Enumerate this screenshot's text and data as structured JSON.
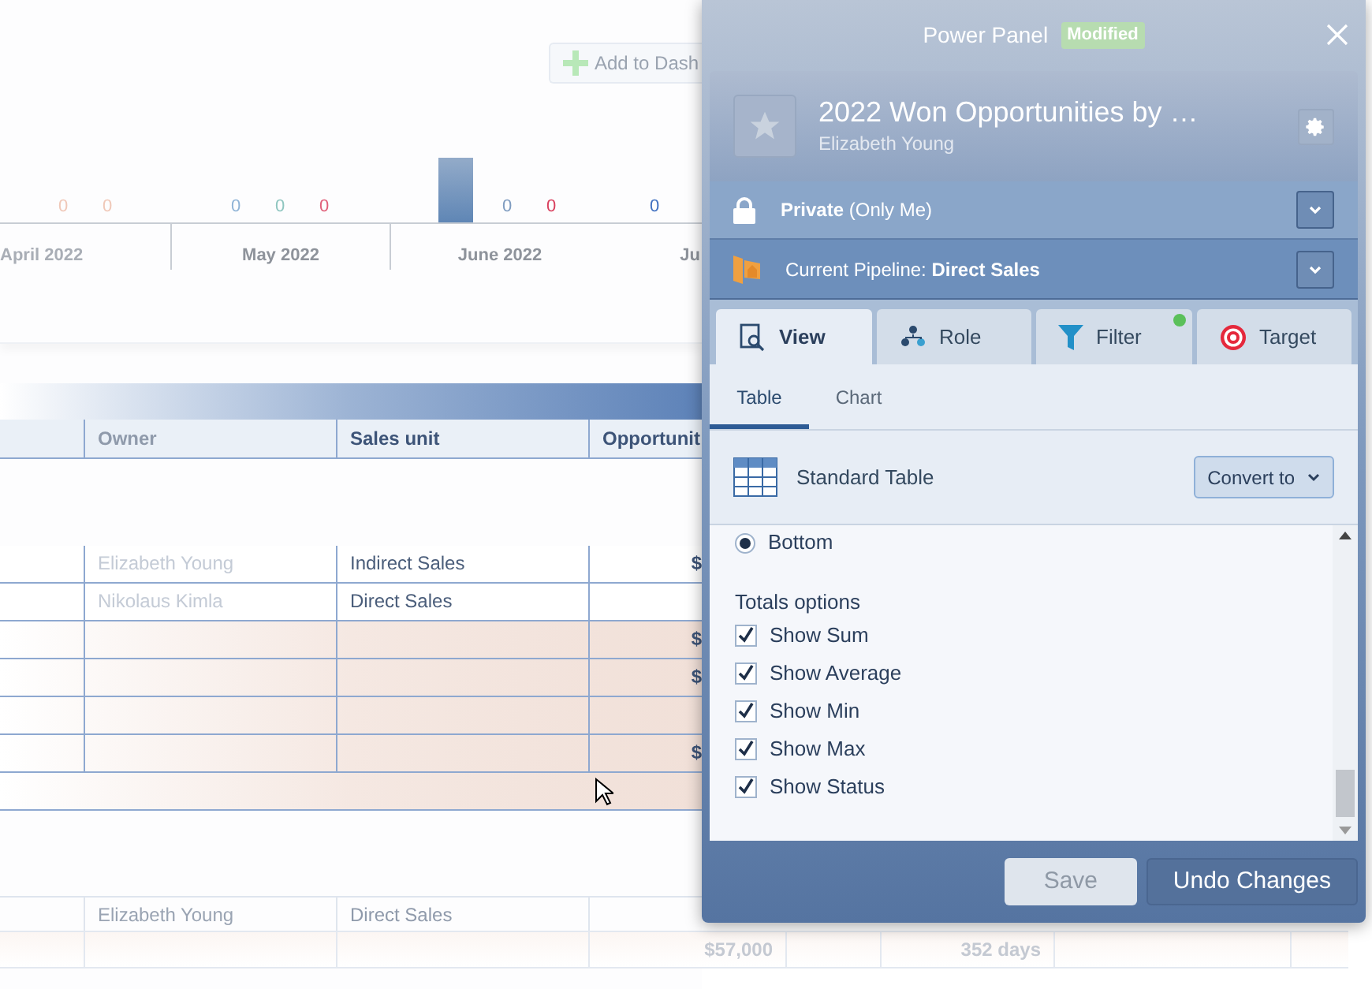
{
  "background": {
    "add_button": "Add to Dash",
    "chart": {
      "months": [
        {
          "label": "April 2022",
          "faded": true,
          "items": [
            {
              "kind": "value",
              "text": "0",
              "color": "#f0c8b8"
            },
            {
              "kind": "value",
              "text": "0",
              "color": "#f0c8b8"
            }
          ]
        },
        {
          "label": "May 2022",
          "faded": false,
          "items": [
            {
              "kind": "value",
              "text": "0",
              "color": "#8fb3d6"
            },
            {
              "kind": "value",
              "text": "0",
              "color": "#8fc6c0"
            },
            {
              "kind": "value",
              "text": "0",
              "color": "#e0607a"
            }
          ]
        },
        {
          "label": "June 2022",
          "faded": false,
          "items": [
            {
              "kind": "bar"
            },
            {
              "kind": "value",
              "text": "0",
              "color": "#7f9cc0"
            },
            {
              "kind": "value",
              "text": "0",
              "color": "#d9405e"
            }
          ]
        },
        {
          "label": "Ju",
          "faded": false,
          "items": [
            {
              "kind": "value",
              "text": "0",
              "color": "#3f6fc0"
            }
          ]
        }
      ]
    },
    "table": {
      "columns": [
        "Owner",
        "Sales unit",
        "Opportunit"
      ],
      "rows": [
        {
          "kind": "plain",
          "cells": [
            "Elizabeth Young",
            "Indirect Sales",
            "$"
          ]
        },
        {
          "kind": "plain",
          "cells": [
            "Nikolaus Kimla",
            "Direct Sales",
            ""
          ]
        },
        {
          "kind": "subtotal",
          "cells": [
            "",
            "",
            "$"
          ]
        },
        {
          "kind": "subtotal",
          "cells": [
            "",
            "",
            "$"
          ]
        },
        {
          "kind": "subtotal",
          "cells": [
            "",
            "",
            ""
          ]
        },
        {
          "kind": "subtotal",
          "cells": [
            "",
            "",
            "$"
          ]
        }
      ],
      "lower_row": [
        "Elizabeth Young",
        "Direct Sales"
      ],
      "total_row": {
        "amount": "$57,000",
        "days": "352 days"
      }
    }
  },
  "panel": {
    "title": "Power Panel",
    "badge": "Modified",
    "report": {
      "name": "2022 Won Opportunities by …",
      "owner": "Elizabeth Young",
      "starred": false
    },
    "sharing": "**Private** (Only Me)",
    "pipeline": "Current Pipeline: **Direct Sales**",
    "tabs": [
      {
        "label": "View",
        "selected": true,
        "indicator": false
      },
      {
        "label": "Role",
        "selected": false,
        "indicator": false
      },
      {
        "label": "Filter",
        "selected": false,
        "indicator": true
      },
      {
        "label": "Target",
        "selected": false,
        "indicator": false
      }
    ],
    "subtabs": [
      {
        "label": "Table",
        "selected": true
      },
      {
        "label": "Chart",
        "selected": false
      }
    ],
    "layout": {
      "label": "Standard Table",
      "button": "Convert to"
    },
    "position_option": {
      "label": "Bottom",
      "selected": true
    },
    "totals_heading": "Totals options",
    "totals": [
      {
        "label": "Show Sum",
        "checked": true
      },
      {
        "label": "Show Average",
        "checked": true
      },
      {
        "label": "Show Min",
        "checked": true
      },
      {
        "label": "Show Max",
        "checked": true
      },
      {
        "label": "Show Status",
        "checked": true
      }
    ],
    "buttons": [
      {
        "label": "Save",
        "disabled": true
      },
      {
        "label": "Undo Changes",
        "disabled": false
      }
    ]
  }
}
